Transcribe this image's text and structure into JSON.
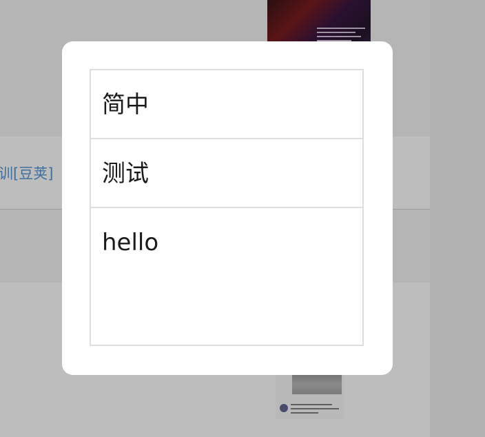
{
  "background": {
    "link_text": "训[豆荚]",
    "overlay_color": "#7f7f7f"
  },
  "modal": {
    "options": [
      {
        "label": "简中"
      },
      {
        "label": "测试"
      },
      {
        "label": "hello"
      }
    ]
  }
}
